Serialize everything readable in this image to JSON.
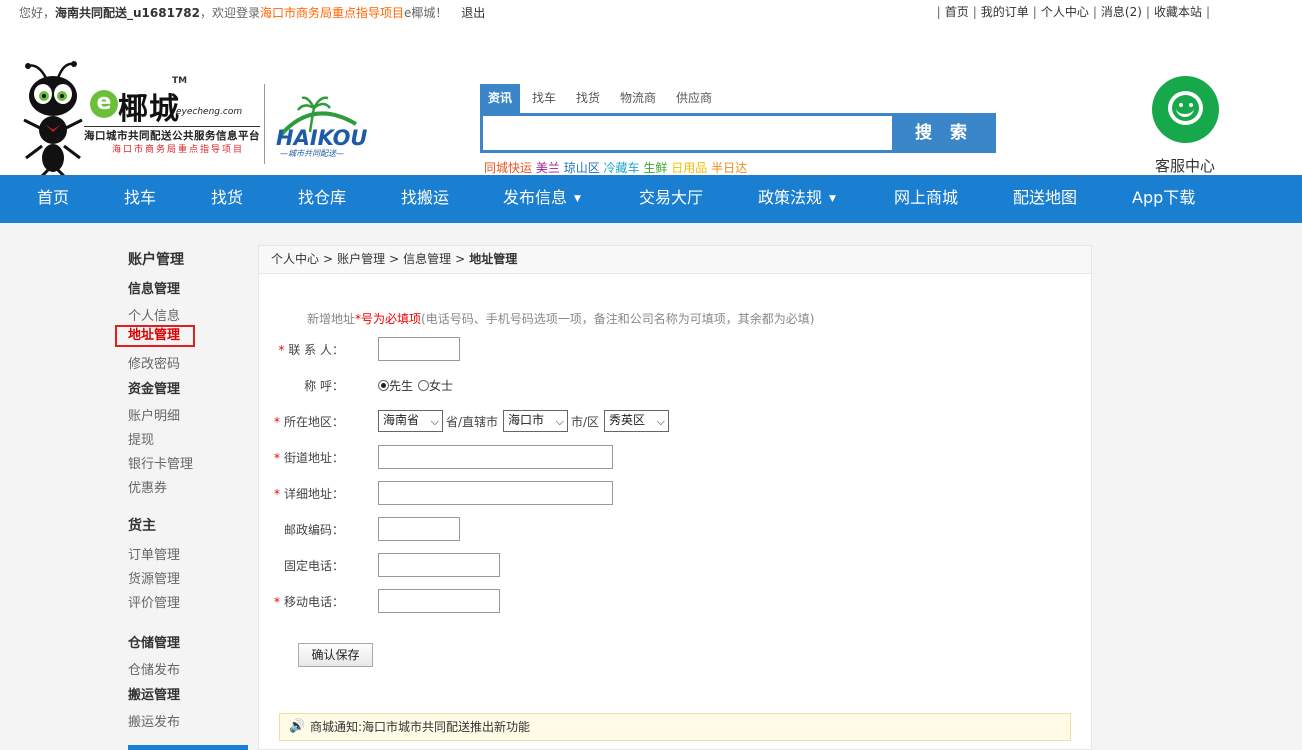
{
  "topbar": {
    "greeting_prefix": "您好，",
    "username": "海南共同配送_u1681782",
    "welcome": "，欢迎登录",
    "highlight": "海口市商务局重点指导项目",
    "site_suffix": "e椰城！",
    "logout": "退出",
    "links": [
      "首页",
      "我的订单",
      "个人中心",
      "消息(2)",
      "收藏本站"
    ]
  },
  "logo": {
    "e": "e",
    "name": "椰城",
    "tm": "TM",
    "domain": "eyecheng.com",
    "subtitle": "海口城市共同配送公共服务信息平台",
    "red_note": "海口市商务局重点指导项目",
    "partner_word": "HAIKOU",
    "partner_sub": "—城市共同配送—"
  },
  "search": {
    "tabs": [
      "资讯",
      "找车",
      "找货",
      "物流商",
      "供应商"
    ],
    "active_tab": "资讯",
    "input_value": "",
    "button": "搜 索",
    "hot": [
      {
        "label": "同城快运",
        "color": "#e8541e"
      },
      {
        "label": "美兰",
        "color": "#a0208c"
      },
      {
        "label": "琼山区",
        "color": "#2470c2"
      },
      {
        "label": "冷藏车",
        "color": "#20a8c8"
      },
      {
        "label": "生鲜",
        "color": "#3aa82e"
      },
      {
        "label": "日用品",
        "color": "#f0c000"
      },
      {
        "label": "半日达",
        "color": "#f08a10"
      }
    ]
  },
  "service": {
    "label": "客服中心",
    "icon": "customer-service-icon"
  },
  "nav": {
    "items": [
      "首页",
      "找车",
      "找货",
      "找仓库",
      "找搬运",
      "发布信息",
      "交易大厅",
      "政策法规",
      "网上商城",
      "配送地图",
      "App下载"
    ]
  },
  "sidebar": {
    "title": "账户管理",
    "sections": [
      {
        "heading": "信息管理",
        "items": [
          "个人信息",
          "地址管理",
          "修改密码"
        ]
      },
      {
        "heading": "资金管理",
        "items": [
          "账户明细",
          "提现",
          "银行卡管理",
          "优惠券"
        ]
      },
      {
        "heading": "货主",
        "items": [
          "订单管理",
          "货源管理",
          "评价管理"
        ]
      },
      {
        "heading": "仓储管理",
        "items": [
          "仓储发布"
        ]
      },
      {
        "heading": "搬运管理",
        "items": [
          "搬运发布"
        ]
      }
    ],
    "active_item": "地址管理"
  },
  "breadcrumb": [
    "个人中心",
    "账户管理",
    "信息管理",
    "地址管理"
  ],
  "form": {
    "note_prefix": "新增地址",
    "note_req": "*号为必填项",
    "note_rest": "(电话号码、手机号码选项一项，备注和公司名称为可填项，其余都为必填)",
    "contact_label": "联 系 人：",
    "title_label": "称 呼：",
    "title_options": [
      "先生",
      "女士"
    ],
    "title_selected": "先生",
    "region_label": "所在地区：",
    "province": "海南省",
    "province_suffix": "省/直辖市",
    "city": "海口市",
    "city_suffix": "市/区",
    "district": "秀英区",
    "street_label": "街道地址：",
    "detail_label": "详细地址：",
    "postcode_label": "邮政编码：",
    "phone_label": "固定电话：",
    "mobile_label": "移动电话：",
    "save_button": "确认保存"
  },
  "notice": "商城通知:海口市城市共同配送推出新功能"
}
